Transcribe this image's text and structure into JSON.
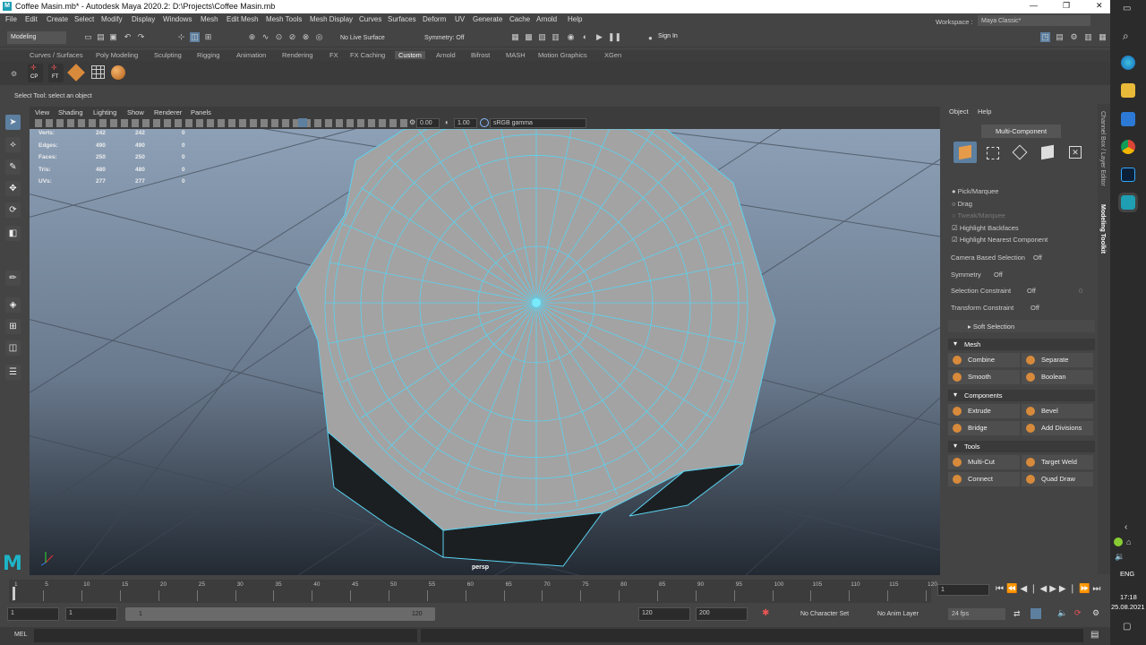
{
  "title_bar": {
    "title": "Coffee Masin.mb* - Autodesk Maya 2020.2: D:\\Projects\\Coffee Masin.mb",
    "min": "—",
    "max": "❐",
    "close": "✕"
  },
  "menus": [
    "File",
    "Edit",
    "Create",
    "Select",
    "Modify",
    "Display",
    "Windows",
    "Mesh",
    "Edit Mesh",
    "Mesh Tools",
    "Mesh Display",
    "Curves",
    "Surfaces",
    "Deform",
    "UV",
    "Generate",
    "Cache",
    "Arnold",
    "Help"
  ],
  "workspace": {
    "label": "Workspace :",
    "value": "Maya Classic*"
  },
  "toolbar": {
    "mode": "Modeling",
    "live_surface": "No Live Surface",
    "symmetry": "Symmetry: Off",
    "sign_in": "Sign In"
  },
  "shelf_tabs": [
    "Curves / Surfaces",
    "Poly Modeling",
    "Sculpting",
    "Rigging",
    "Animation",
    "Rendering",
    "FX",
    "FX Caching",
    "Custom",
    "Arnold",
    "Bifrost",
    "MASH",
    "Motion Graphics",
    "XGen"
  ],
  "shelf_active": "Custom",
  "shelf_icons": {
    "cp": "CP",
    "ft": "FT"
  },
  "help_line": "Select Tool: select an object",
  "viewport": {
    "menus": [
      "View",
      "Shading",
      "Lighting",
      "Show",
      "Renderer",
      "Panels"
    ],
    "exposure": "0.00",
    "gamma": "1.00",
    "color_space": "sRGB gamma",
    "camera": "persp",
    "hud": [
      {
        "label": "Verts:",
        "a": "242",
        "b": "242",
        "c": "0"
      },
      {
        "label": "Edges:",
        "a": "490",
        "b": "490",
        "c": "0"
      },
      {
        "label": "Faces:",
        "a": "250",
        "b": "250",
        "c": "0"
      },
      {
        "label": "Tris:",
        "a": "480",
        "b": "480",
        "c": "0"
      },
      {
        "label": "UVs:",
        "a": "277",
        "b": "277",
        "c": "0"
      }
    ]
  },
  "modeling_toolkit": {
    "menus": [
      "Object",
      "Help"
    ],
    "mode_button": "Multi-Component",
    "options": {
      "pick": "Pick/Marquee",
      "drag": "Drag",
      "tweak": "Tweak/Marquee",
      "backfaces": "Highlight Backfaces",
      "nearest": "Highlight Nearest Component"
    },
    "camera_sel": {
      "label": "Camera Based Selection",
      "value": "Off"
    },
    "symmetry": {
      "label": "Symmetry",
      "value": "Off"
    },
    "sel_constraint": {
      "label": "Selection Constraint",
      "value": "Off",
      "num": "0"
    },
    "xform_constraint": {
      "label": "Transform Constraint",
      "value": "Off"
    },
    "soft_selection": "Soft Selection",
    "mesh": {
      "title": "Mesh",
      "buttons": [
        "Combine",
        "Separate",
        "Smooth",
        "Boolean"
      ]
    },
    "components": {
      "title": "Components",
      "buttons": [
        "Extrude",
        "Bevel",
        "Bridge",
        "Add Divisions"
      ]
    },
    "tools": {
      "title": "Tools",
      "buttons": [
        "Multi-Cut",
        "Target Weld",
        "Connect",
        "Quad Draw"
      ]
    },
    "side_tabs": [
      "Channel Box / Layer Editor",
      "Modeling Toolkit"
    ]
  },
  "timeline": {
    "ticks": [
      "1",
      "5",
      "10",
      "15",
      "20",
      "25",
      "30",
      "35",
      "40",
      "45",
      "50",
      "55",
      "60",
      "65",
      "70",
      "75",
      "80",
      "85",
      "90",
      "95",
      "100",
      "105",
      "110",
      "115",
      "120"
    ],
    "current_frame": "1"
  },
  "range": {
    "start": "1",
    "start2": "1",
    "slider_start": "1",
    "slider_end": "120",
    "end": "120",
    "end2": "200",
    "character_set": "No Character Set",
    "anim_layer": "No Anim Layer",
    "fps": "24 fps"
  },
  "command_line": {
    "label": "MEL"
  },
  "taskbar": {
    "lang": "ENG",
    "time": "17:18",
    "date": "25.08.2021"
  },
  "colors": {
    "accent": "#5ad2f0",
    "orange": "#d78a3b",
    "panel": "#444444"
  }
}
